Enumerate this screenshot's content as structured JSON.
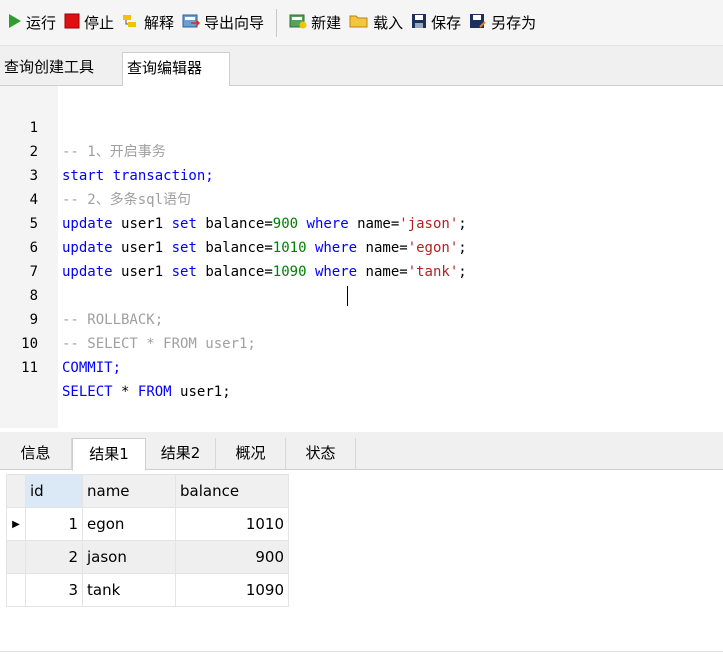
{
  "toolbar": {
    "run": "运行",
    "stop": "停止",
    "explain": "解释",
    "export_wizard": "导出向导",
    "new": "新建",
    "load": "载入",
    "save": "保存",
    "save_as": "另存为"
  },
  "top_tabs": [
    "查询创建工具",
    "查询编辑器"
  ],
  "editor": {
    "lines": [
      {
        "n": "1",
        "cmt": "-- 1、开启事务"
      },
      {
        "n": "2"
      },
      {
        "n": "3",
        "cmt": "-- 2、多条sql语句"
      },
      {
        "n": "4"
      },
      {
        "n": "5"
      },
      {
        "n": "6"
      },
      {
        "n": "7"
      },
      {
        "n": "8",
        "cmt": "-- ROLLBACK;"
      },
      {
        "n": "9",
        "cmt": "-- SELECT * FROM user1;"
      },
      {
        "n": "10"
      },
      {
        "n": "11"
      }
    ],
    "tokens": {
      "start_transaction": "start transaction;",
      "update": "update",
      "user1_set": "user1",
      "set": "set",
      "balance_eq": "balance=",
      "where": "where",
      "name_eq": "name=",
      "semi": ";",
      "v900": "900",
      "v1010": "1010",
      "v1090": "1090",
      "s_jason": "'jason'",
      "s_egon": "'egon'",
      "s_tank": "'tank'",
      "commit": "COMMIT;",
      "select": "SELECT",
      "star": "*",
      "from": "FROM",
      "user1_semi": "user1;"
    }
  },
  "bottom_tabs": [
    "信息",
    "结果1",
    "结果2",
    "概况",
    "状态"
  ],
  "grid": {
    "columns": [
      "id",
      "name",
      "balance"
    ],
    "rows": [
      {
        "id": "1",
        "name": "egon",
        "balance": "1010"
      },
      {
        "id": "2",
        "name": "jason",
        "balance": "900"
      },
      {
        "id": "3",
        "name": "tank",
        "balance": "1090"
      }
    ],
    "current_row_marker": "▶"
  }
}
